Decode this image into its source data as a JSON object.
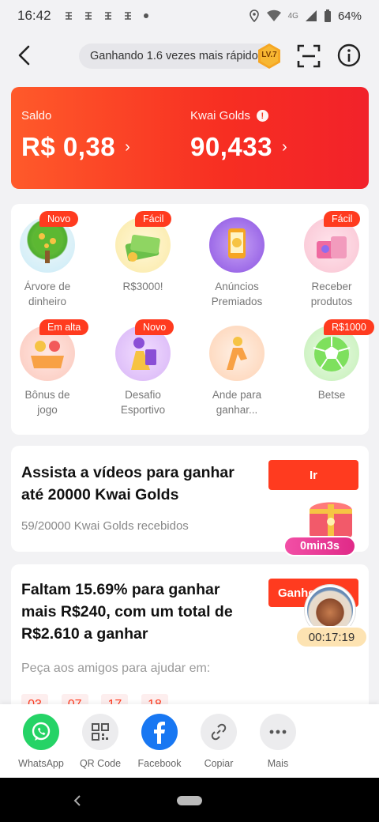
{
  "status_bar": {
    "time": "16:42",
    "battery": "64%",
    "network": "4G"
  },
  "header": {
    "speed_text": "Ganhando 1.6 vezes mais rápido",
    "level_badge": "LV.7"
  },
  "balance": {
    "saldo_label": "Saldo",
    "saldo_value": "R$ 0,38",
    "golds_label": "Kwai Golds",
    "golds_value": "90,433",
    "info_symbol": "!",
    "chevron": "›"
  },
  "grid_items": [
    {
      "tag": "Novo",
      "label_line1": "Árvore de",
      "label_line2": "dinheiro",
      "icon": "money-tree-icon"
    },
    {
      "tag": "Fácil",
      "label_line1": "R$3000!",
      "label_line2": "",
      "icon": "cash-stack-icon"
    },
    {
      "tag": "",
      "label_line1": "Anúncios",
      "label_line2": "Premiados",
      "icon": "phone-coin-icon"
    },
    {
      "tag": "Fácil",
      "label_line1": "Receber",
      "label_line2": "produtos",
      "icon": "gift-products-icon"
    },
    {
      "tag": "Em alta",
      "label_line1": "Bônus de",
      "label_line2": "jogo",
      "icon": "game-bonus-icon"
    },
    {
      "tag": "Novo",
      "label_line1": "Desafio",
      "label_line2": "Esportivo",
      "icon": "sports-challenge-icon"
    },
    {
      "tag": "",
      "label_line1": "Ande para",
      "label_line2": "ganhar...",
      "icon": "walking-icon"
    },
    {
      "tag": "R$1000",
      "label_line1": "Betse",
      "label_line2": "",
      "icon": "soccer-ball-icon"
    }
  ],
  "watch": {
    "title": "Assista a vídeos para ganhar até 20000 Kwai Golds",
    "progress": "59/20000 Kwai Golds recebidos",
    "button": "Ir",
    "timer": "0min3s"
  },
  "goal": {
    "title": "Faltam 15.69% para ganhar mais R$240, com um total de R$2.610 a ganhar",
    "button": "Ganhe",
    "timer": "00:17:19",
    "ask_friends": "Peça aos amigos para ajudar em:",
    "countdown": [
      "03",
      "07",
      "17",
      "18"
    ]
  },
  "share": [
    {
      "label": "WhatsApp",
      "color": "#25d366"
    },
    {
      "label": "QR Code",
      "color": "#ececee"
    },
    {
      "label": "Facebook",
      "color": "#1877f2"
    },
    {
      "label": "Copiar",
      "color": "#ececee"
    },
    {
      "label": "Mais",
      "color": "#ececee"
    }
  ],
  "colors": {
    "accent": "#ff3b1f",
    "card_start": "#ff5a2a",
    "card_end": "#f2222a"
  }
}
